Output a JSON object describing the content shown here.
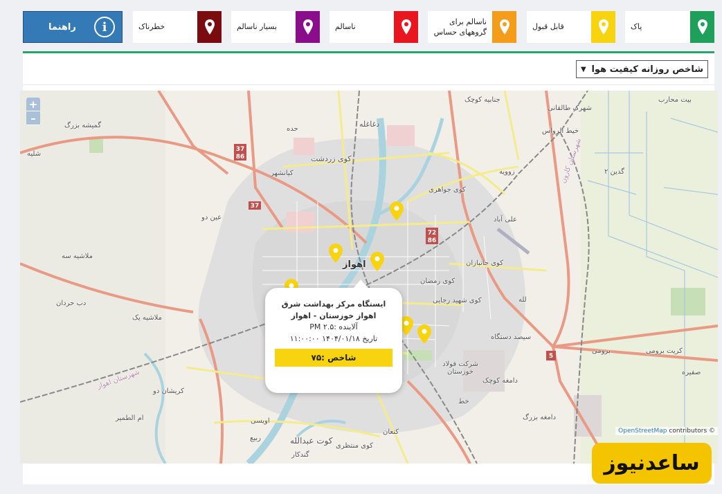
{
  "legend": {
    "guide_label": "راهنما",
    "items": [
      {
        "label": "پاک",
        "color": "#1fa05a"
      },
      {
        "label": "قابل قبول",
        "color": "#f7d310"
      },
      {
        "label": "ناسالم برای گروههای حساس",
        "color": "#f49d1a"
      },
      {
        "label": "ناسالم",
        "color": "#e8161e"
      },
      {
        "label": "بسیار ناسالم",
        "color": "#8a0d8c"
      },
      {
        "label": "خطرناک",
        "color": "#7a0b0f"
      }
    ]
  },
  "panel": {
    "select_value": "شاخص روزانه کیفیت هوا"
  },
  "map": {
    "zoom_in": "+",
    "zoom_out": "–",
    "attribution_link": "OpenStreetMap",
    "attribution_rest": "contributors ©",
    "places": {
      "city": "اهواز",
      "dagheleh": "دغاغله",
      "kuy_zardasht": "کوی زردشت",
      "kianshahr": "کیانشهر",
      "kuy_javaheri": "کوی جواهری",
      "zavie": "زوویه",
      "ali_abad": "علی آباد",
      "kuy_janbazan": "کوی جانبازان",
      "kuy_ramazan": "کوی رمضان",
      "kuy_shahid_rajai": "کوی شهید رجایی",
      "lah": "لله",
      "sepid_dastgah": "سیصد دستگاه",
      "karit_broumi": "کریت برومی",
      "broumi": "برومی",
      "sefire": "صفیره",
      "damaneh_kuchak": "دامغه کوچک",
      "damaneh_bozorg": "دامغه بزرگ",
      "khat": "خط",
      "foolad": "شرکت فولاد خوزستان",
      "kut_abdollah": "کوت عبدالله",
      "kuy_montazeri": "کوی منتظری",
      "rabi": "ربیع",
      "ovisi": "اویسی",
      "kenan": "کنعان",
      "gandkar": "گندکار",
      "om_tamir": "ام الطمیر",
      "karishan_do": "کریشان دو",
      "mollashieh_yek": "ملاشیه یک",
      "mollashieh_seh": "ملاشیه سه",
      "dabb_hardan": "دب حردان",
      "eyn_do": "عین دو",
      "ghomishe_bozorg": "گمیشه بزرگ",
      "shaleh": "شلیه",
      "janbieh_kuchak": "جنابیه کوچک",
      "shahrak_taleghani": "شهرک طالقانی",
      "khit_alravas": "خیط الرواس",
      "beyt_moharreb": "بیت محارب",
      "godin2": "گدین ۲",
      "hadde": "حده",
      "shahrestan_karun": "شهرستان کارون",
      "shahrestan_ahvaz": "شهرستان اهواز"
    },
    "road_shields": [
      "37",
      "86",
      "37",
      "72",
      "86",
      "5"
    ]
  },
  "popup": {
    "title": "ایستگاه مرکز بهداشت شرق اهواز خوزستان - اهواز",
    "pollutant": "آلاینده :PM ۲.۵",
    "date": "تاریخ ۱۴۰۴/۰۱/۱۸ ۱۱:۰۰:۰۰",
    "index_label": "شاخص :۷۵"
  },
  "watermark": "ساعدنیوز"
}
